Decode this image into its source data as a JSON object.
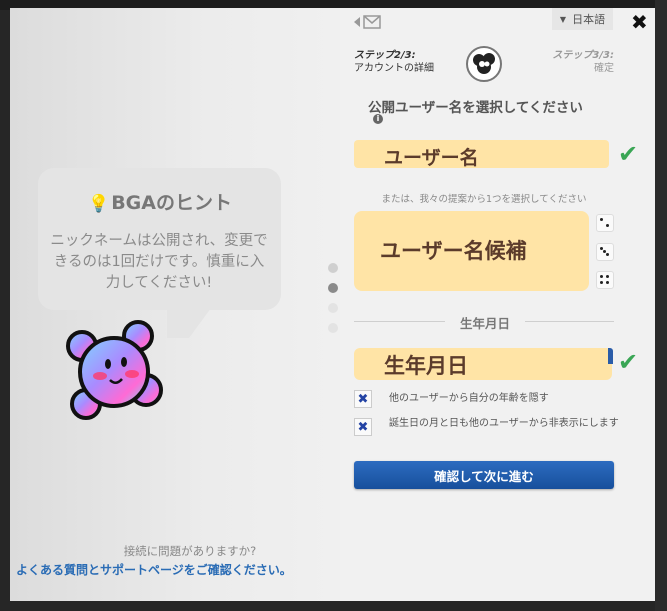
{
  "hint": {
    "title": "BGAのヒント",
    "text": "ニックネームは公開され、変更できるのは1回だけです。慎重に入力してください!"
  },
  "pagination": {
    "total": 4,
    "active_index": 1
  },
  "footer": {
    "question": "接続に問題がありますか?",
    "link": "よくある質問とサポートページをご確認ください。"
  },
  "header": {
    "language": "日本語",
    "close_symbol": "✖",
    "current_step": {
      "label": "ステップ2/3:",
      "name": "アカウントの詳細"
    },
    "next_step": {
      "label": "ステップ3/3:",
      "name": "確定"
    }
  },
  "username": {
    "section_label": "公開ユーザー名を選択してください",
    "value": "ユーザー名",
    "suggest_caption": "または、我々の提案から1つを選択してください",
    "suggestion": "ユーザー名候補"
  },
  "dob": {
    "divider_label": "生年月日",
    "value": "生年月日"
  },
  "options": [
    {
      "label": "他のユーザーから自分の年齢を隠す",
      "checked": true
    },
    {
      "label": "誕生日の月と日も他のユーザーから非表示にします",
      "checked": true
    }
  ],
  "confirm_button": "確認して次に進む",
  "colors": {
    "accent": "#2a5ca8",
    "field": "#ffe4a6",
    "check": "#3aa655"
  }
}
